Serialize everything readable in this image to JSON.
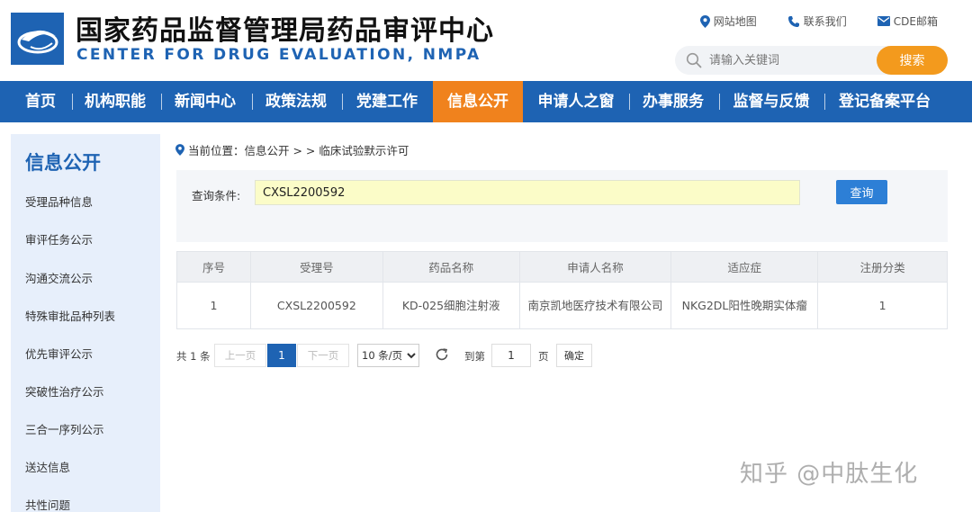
{
  "header": {
    "title_cn": "国家药品监督管理局药品审评中心",
    "title_en": "CENTER FOR DRUG EVALUATION, NMPA",
    "links": [
      {
        "label": "网站地图",
        "icon": "location-pin-icon"
      },
      {
        "label": "联系我们",
        "icon": "phone-icon"
      },
      {
        "label": "CDE邮箱",
        "icon": "mail-icon"
      }
    ],
    "search": {
      "placeholder": "请输入关键词",
      "button": "搜索"
    }
  },
  "nav": {
    "items": [
      "首页",
      "机构职能",
      "新闻中心",
      "政策法规",
      "党建工作",
      "信息公开",
      "申请人之窗",
      "办事服务",
      "监督与反馈",
      "登记备案平台"
    ],
    "active_index": 5
  },
  "sidebar": {
    "title": "信息公开",
    "items": [
      "受理品种信息",
      "审评任务公示",
      "沟通交流公示",
      "特殊审批品种列表",
      "优先审评公示",
      "突破性治疗公示",
      "三合一序列公示",
      "送达信息",
      "共性问题"
    ]
  },
  "breadcrumb": "当前位置：信息公开 > > 临床试验默示许可",
  "query": {
    "label": "查询条件:",
    "value": "CXSL2200592",
    "button": "查询"
  },
  "table": {
    "columns": [
      "序号",
      "受理号",
      "药品名称",
      "申请人名称",
      "适应症",
      "注册分类"
    ],
    "rows": [
      [
        "1",
        "CXSL2200592",
        "KD-025细胞注射液",
        "南京凯地医疗技术有限公司",
        "NKG2DL阳性晚期实体瘤",
        "1"
      ]
    ]
  },
  "pager": {
    "total": "共 1 条",
    "prev": "上一页",
    "current": "1",
    "next": "下一页",
    "page_size": "10 条/页",
    "goto_label": "到第",
    "goto_value": "1",
    "page_label": "页",
    "confirm": "确定"
  },
  "watermark": "知乎 @中肽生化",
  "colors": {
    "primary": "#1e63b3",
    "accent": "#f0821d",
    "query_bg": "#fbfcc8"
  }
}
